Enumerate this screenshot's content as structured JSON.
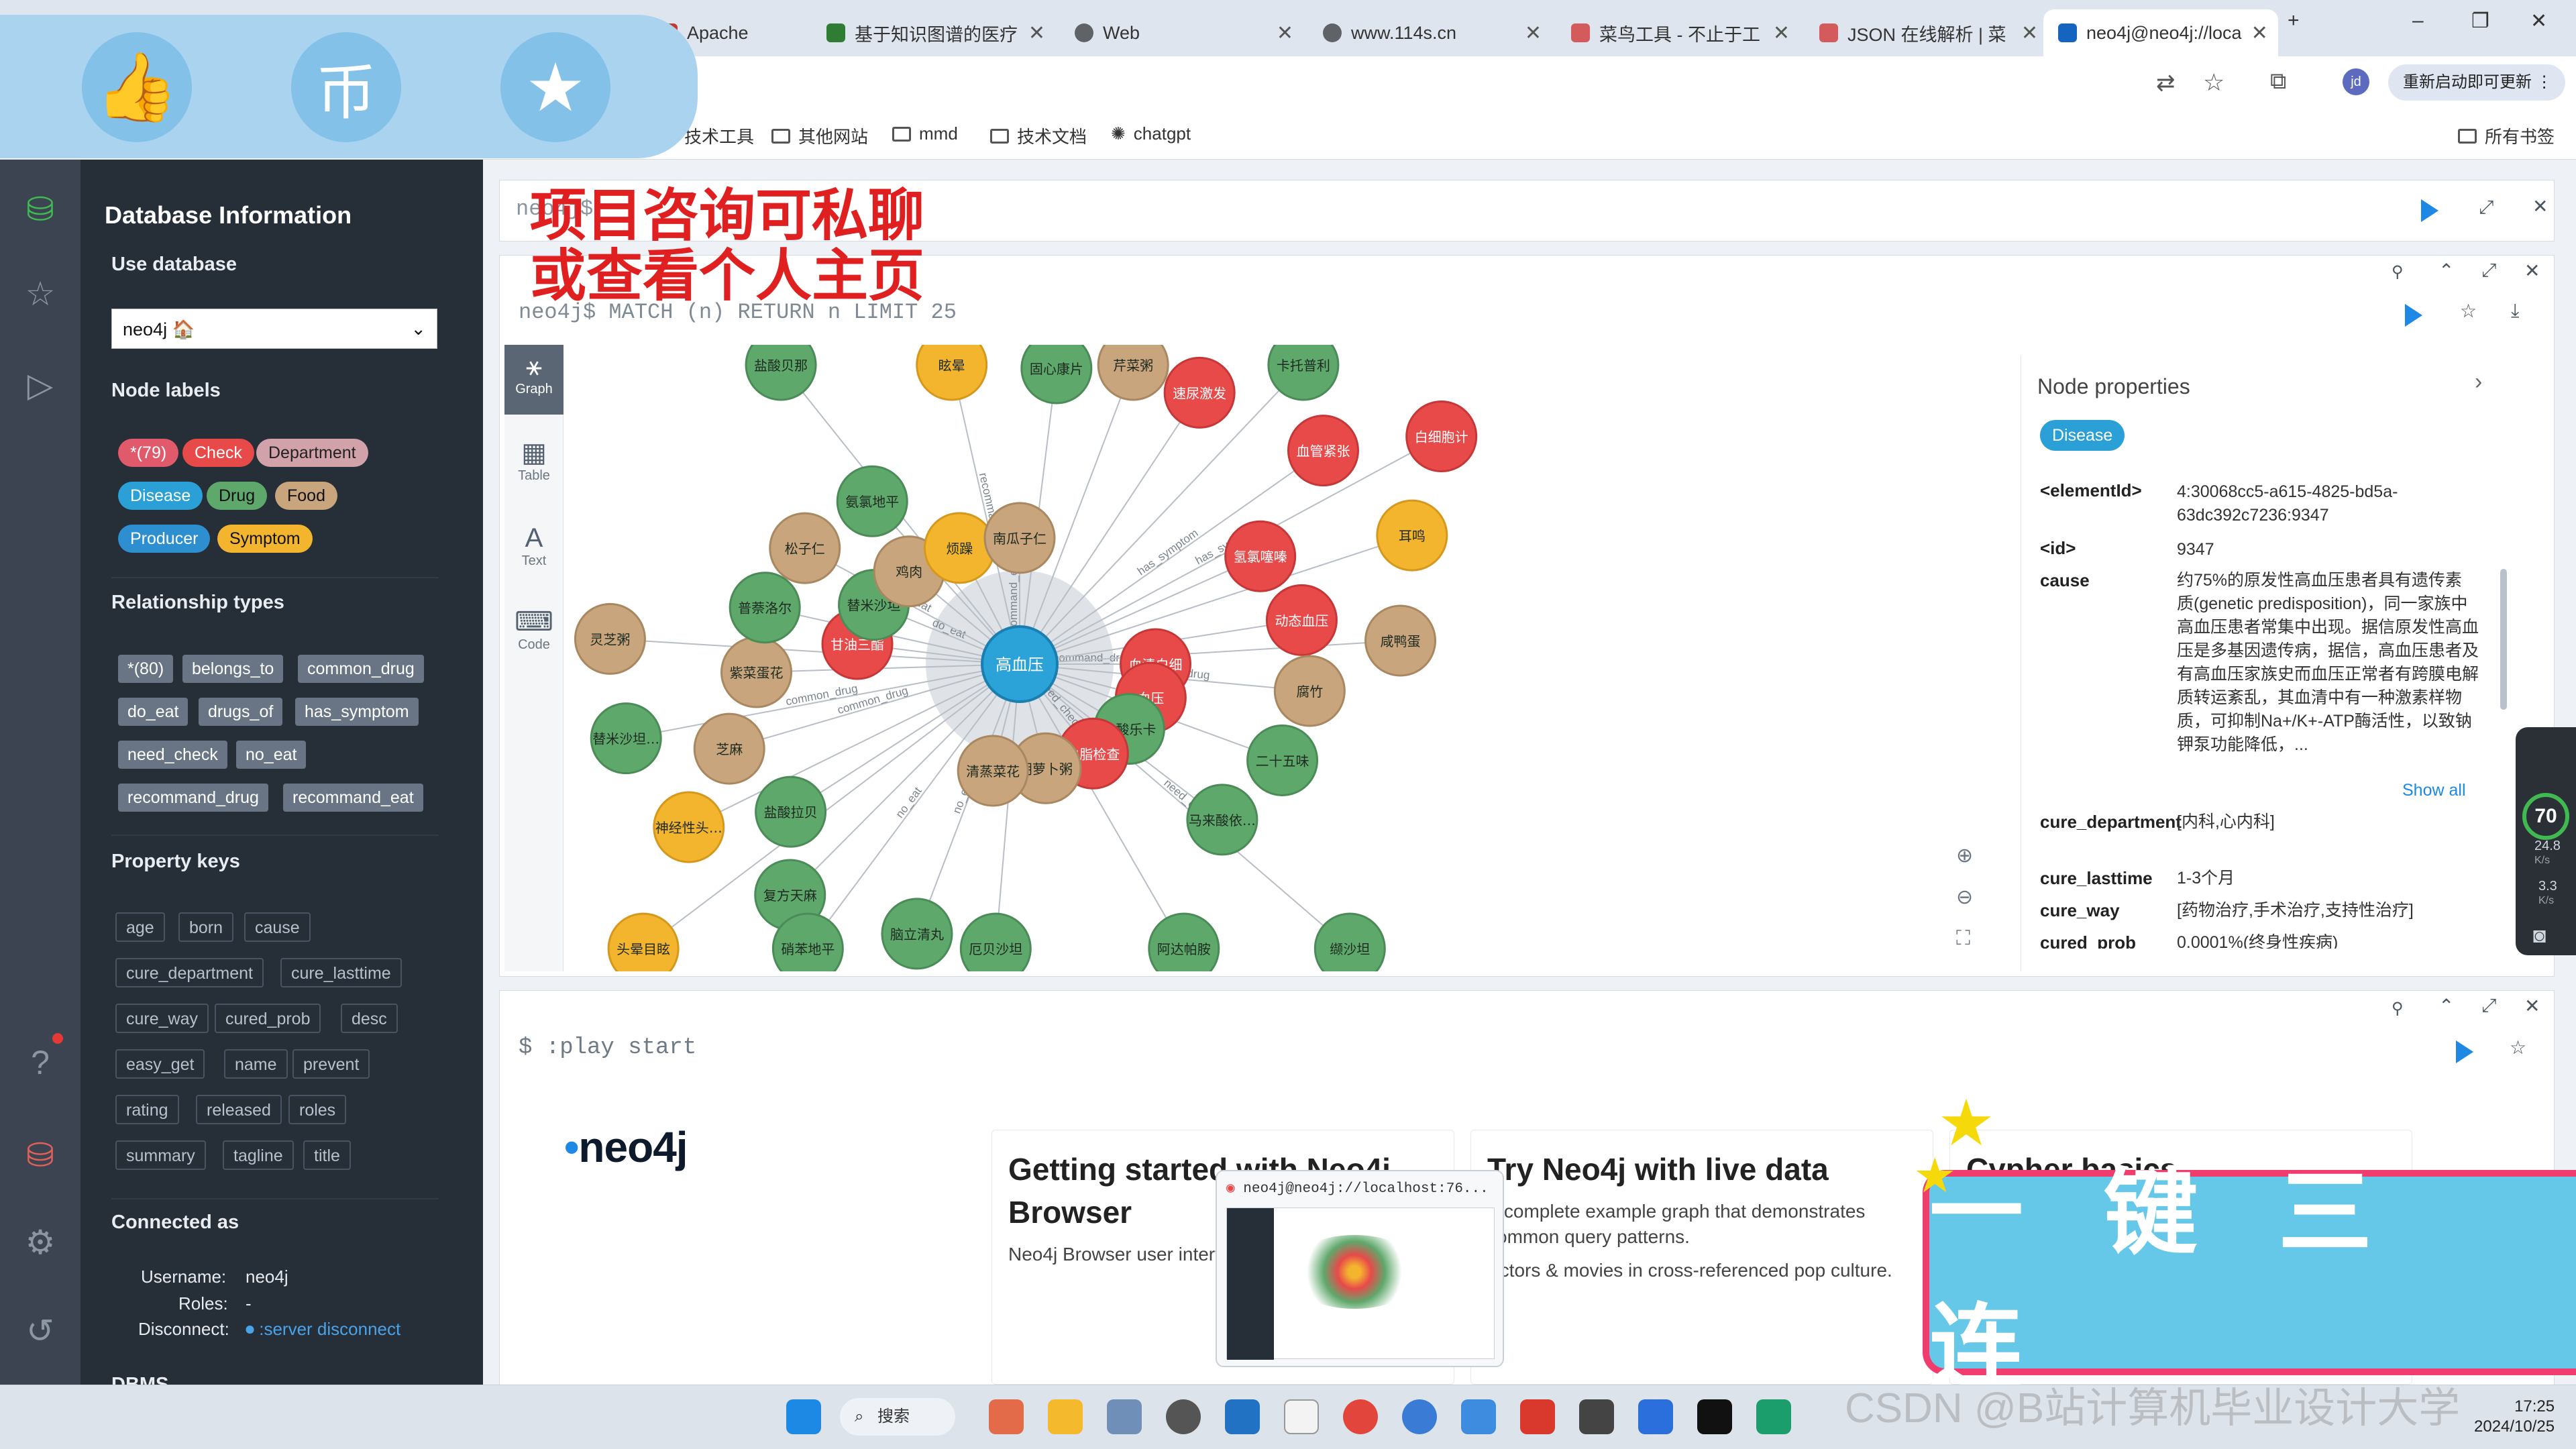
{
  "browser": {
    "tabs": [
      {
        "label": "Apache",
        "color": "#c7392a"
      },
      {
        "label": "基于知识图谱的医疗",
        "color": "#2e7d32"
      },
      {
        "label": "Web",
        "color": "#5f6368"
      },
      {
        "label": "www.114s.cn",
        "color": "#5f6368"
      },
      {
        "label": "菜鸟工具 - 不止于工",
        "color": "#d35b5b"
      },
      {
        "label": "JSON 在线解析 | 菜",
        "color": "#d35b5b"
      },
      {
        "label": "neo4j@neo4j://loca",
        "color": "#1565c0"
      }
    ],
    "update_button": "重新启动即可更新",
    "profile": "jd",
    "bookmarks": [
      "技术工具",
      "其他网站",
      "mmd",
      "技术文档",
      "chatgpt"
    ],
    "all_bookmarks": "所有书签"
  },
  "overlay": {
    "promo_line1": "项目咨询可私聊",
    "promo_line2": "或查看个人主页",
    "big_button": "一键三连",
    "watermark": "CSDN @B站计算机毕业设计大学"
  },
  "sidebar": {
    "title": "Database Information",
    "use_database_label": "Use database",
    "database": "neo4j 🏠",
    "node_labels_title": "Node labels",
    "node_labels": [
      {
        "label": "*(79)",
        "color": "#e05a6b"
      },
      {
        "label": "Check",
        "color": "#e84a4a"
      },
      {
        "label": "Department",
        "color": "#d1a2a9"
      },
      {
        "label": "Disease",
        "color": "#2aa0d6"
      },
      {
        "label": "Drug",
        "color": "#5fa86c"
      },
      {
        "label": "Food",
        "color": "#c8a57c"
      },
      {
        "label": "Producer",
        "color": "#2e8fd0"
      },
      {
        "label": "Symptom",
        "color": "#f3b52e"
      }
    ],
    "relationship_title": "Relationship types",
    "relationships": [
      "*(80)",
      "belongs_to",
      "common_drug",
      "do_eat",
      "drugs_of",
      "has_symptom",
      "need_check",
      "no_eat",
      "recommand_drug",
      "recommand_eat"
    ],
    "property_title": "Property keys",
    "property_keys": [
      "age",
      "born",
      "cause",
      "cure_department",
      "cure_lasttime",
      "cure_way",
      "cured_prob",
      "desc",
      "easy_get",
      "name",
      "prevent",
      "rating",
      "released",
      "roles",
      "summary",
      "tagline",
      "title"
    ],
    "connected_title": "Connected as",
    "username_label": "Username:",
    "username": "neo4j",
    "roles_label": "Roles:",
    "roles": "-",
    "disconnect_label": "Disconnect:",
    "disconnect_link": ":server disconnect",
    "dbms_title": "DBMS"
  },
  "editor": {
    "prompt": "neo4j$"
  },
  "result_frame": {
    "query": "neo4j$ MATCH (n) RETURN n LIMIT 25",
    "view_tabs": [
      "Graph",
      "Table",
      "Text",
      "Code"
    ]
  },
  "graph": {
    "center": {
      "label": "高血压",
      "color": "#2ba3d8"
    },
    "nodes": [
      {
        "label": "血清白细",
        "type": "check"
      },
      {
        "label": "盐酸拉贝",
        "type": "drug"
      },
      {
        "label": "固心康片",
        "type": "drug"
      },
      {
        "label": "缬沙坦",
        "type": "drug"
      },
      {
        "label": "甘油三酯",
        "type": "check"
      },
      {
        "label": "氢氯噻嗪",
        "type": "check"
      },
      {
        "label": "脑立清丸",
        "type": "drug"
      },
      {
        "label": "盐酸贝那",
        "type": "drug"
      },
      {
        "label": "血压",
        "type": "check"
      },
      {
        "label": "芝麻",
        "type": "food"
      },
      {
        "label": "速尿激发",
        "type": "check"
      },
      {
        "label": "阿达帕胺",
        "type": "drug"
      },
      {
        "label": "替米沙坦",
        "type": "drug"
      },
      {
        "label": "动态血压",
        "type": "check"
      },
      {
        "label": "复方天麻",
        "type": "drug"
      },
      {
        "label": "眩晕",
        "type": "symptom"
      },
      {
        "label": "盐酸乐卡",
        "type": "drug"
      },
      {
        "label": "紫菜蛋花",
        "type": "food"
      },
      {
        "label": "血管紧张",
        "type": "check"
      },
      {
        "label": "厄贝沙坦",
        "type": "drug"
      },
      {
        "label": "鸡肉",
        "type": "food"
      },
      {
        "label": "腐竹",
        "type": "food"
      },
      {
        "label": "神经性头痛",
        "type": "symptom"
      },
      {
        "label": "芹菜粥",
        "type": "food"
      },
      {
        "label": "血脂检查",
        "type": "check"
      },
      {
        "label": "普萘洛尔",
        "type": "drug"
      },
      {
        "label": "耳鸣",
        "type": "symptom"
      },
      {
        "label": "硝苯地平",
        "type": "drug"
      },
      {
        "label": "烦躁",
        "type": "symptom"
      },
      {
        "label": "二十五味",
        "type": "drug"
      },
      {
        "label": "替米沙坦片",
        "type": "drug"
      },
      {
        "label": "卡托普利",
        "type": "drug"
      },
      {
        "label": "胡萝卜粥",
        "type": "food"
      },
      {
        "label": "松子仁",
        "type": "food"
      },
      {
        "label": "咸鸭蛋",
        "type": "food"
      },
      {
        "label": "头晕目眩",
        "type": "symptom"
      },
      {
        "label": "南瓜子仁",
        "type": "food"
      },
      {
        "label": "马来酸依那",
        "type": "drug"
      },
      {
        "label": "灵芝粥",
        "type": "food"
      },
      {
        "label": "白细胞计",
        "type": "check"
      },
      {
        "label": "清蒸菜花",
        "type": "food"
      },
      {
        "label": "氨氯地平",
        "type": "drug"
      }
    ],
    "edge_labels": [
      "recommand_drug",
      "recommand_eat",
      "common_drug",
      "need_check",
      "has_symptom",
      "do_eat",
      "no_eat"
    ]
  },
  "node_properties": {
    "title": "Node properties",
    "badge": "Disease",
    "rows": [
      {
        "key": "<elementId>",
        "value": "4:30068cc5-a615-4825-bd5a-63dc392c7236:9347"
      },
      {
        "key": "<id>",
        "value": "9347"
      },
      {
        "key": "cause",
        "value": "约75%的原发性高血压患者具有遗传素质(genetic predisposition)，同一家族中高血压患者常集中出现。据信原发性高血压是多基因遗传病，据信，高血压患者及有高血压家族史而血压正常者有跨膜电解质转运紊乱，其血清中有一种激素样物质，可抑制Na+/K+-ATP酶活性，以致钠钾泵功能降低，..."
      },
      {
        "key": "cure_department",
        "value": "[内科,心内科]"
      },
      {
        "key": "cure_lasttime",
        "value": "1-3个月"
      },
      {
        "key": "cure_way",
        "value": "[药物治疗,手术治疗,支持性治疗]"
      },
      {
        "key": "cured_prob",
        "value": "0.0001%(终身性疾病)"
      }
    ],
    "show_all": "Show all"
  },
  "speed_widget": {
    "score": "70",
    "up": "24.8",
    "down": "3.3",
    "unit": "K/s"
  },
  "start_frame": {
    "query": "$ :play start",
    "logo": "neo4j",
    "cards": [
      {
        "title": "Getting started with Neo4j Browser",
        "text": "Neo4j Browser user interface guide."
      },
      {
        "title": "Try Neo4j with live data",
        "text": "A complete example graph that demonstrates common query patterns.",
        "text2": "Actors & movies in cross-referenced pop culture."
      },
      {
        "title": "Cypher basics",
        "text": ""
      }
    ]
  },
  "popup": {
    "title": "neo4j@neo4j://localhost:76..."
  },
  "taskbar": {
    "search": "搜索",
    "time": "17:25",
    "date": "2024/10/25"
  }
}
